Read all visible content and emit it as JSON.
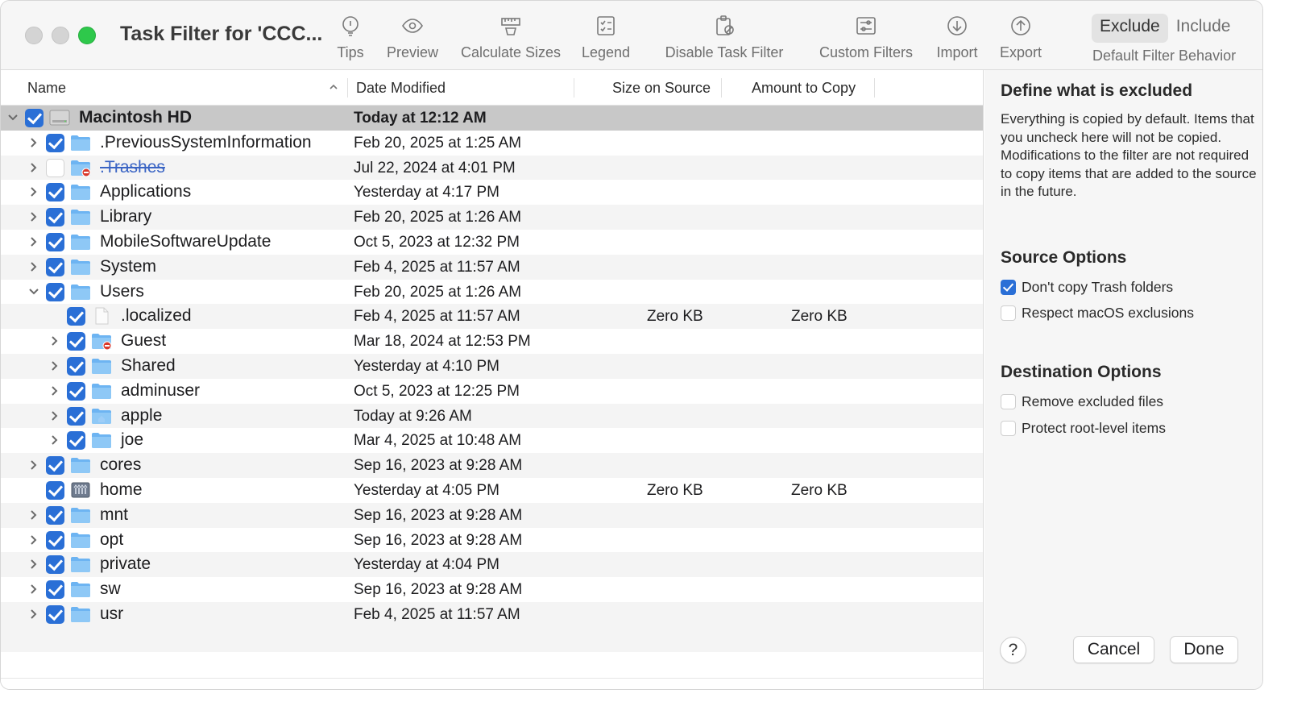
{
  "window": {
    "title": "Task Filter for 'CCC..."
  },
  "toolbar": {
    "buttons": [
      {
        "label": "Tips",
        "icon": "lightbulb-icon"
      },
      {
        "label": "Preview",
        "icon": "eye-icon"
      },
      {
        "label": "Calculate Sizes",
        "icon": "ruler-icon"
      },
      {
        "label": "Legend",
        "icon": "checklist-icon"
      },
      {
        "label": "Disable Task Filter",
        "icon": "clipboard-slash-icon"
      },
      {
        "label": "Custom Filters",
        "icon": "sliders-icon"
      },
      {
        "label": "Import",
        "icon": "arrow-down-circle-icon"
      },
      {
        "label": "Export",
        "icon": "arrow-up-circle-icon"
      }
    ],
    "filter_behavior": {
      "options": [
        "Exclude",
        "Include"
      ],
      "selected": "Exclude",
      "label": "Default Filter Behavior"
    }
  },
  "table": {
    "columns": [
      "Name",
      "Date Modified",
      "Size on Source",
      "Amount to Copy"
    ],
    "rows": [
      {
        "level": 0,
        "name": "Macintosh HD",
        "date": "Today at 12:12 AM",
        "size": "",
        "amount": "",
        "checked": true,
        "icon": "disk",
        "disclosure": "expanded",
        "selected": true
      },
      {
        "level": 1,
        "name": ".PreviousSystemInformation",
        "date": "Feb 20, 2025 at 1:25 AM",
        "size": "",
        "amount": "",
        "checked": true,
        "icon": "folder",
        "disclosure": "collapsed"
      },
      {
        "level": 1,
        "name": ".Trashes",
        "date": "Jul 22, 2024 at 4:01 PM",
        "size": "",
        "amount": "",
        "checked": false,
        "icon": "folder-restricted",
        "disclosure": "collapsed",
        "excluded": true
      },
      {
        "level": 1,
        "name": "Applications",
        "date": "Yesterday at 4:17 PM",
        "size": "",
        "amount": "",
        "checked": true,
        "icon": "folder",
        "disclosure": "collapsed"
      },
      {
        "level": 1,
        "name": "Library",
        "date": "Feb 20, 2025 at 1:26 AM",
        "size": "",
        "amount": "",
        "checked": true,
        "icon": "folder",
        "disclosure": "collapsed"
      },
      {
        "level": 1,
        "name": "MobileSoftwareUpdate",
        "date": "Oct 5, 2023 at 12:32 PM",
        "size": "",
        "amount": "",
        "checked": true,
        "icon": "folder",
        "disclosure": "collapsed"
      },
      {
        "level": 1,
        "name": "System",
        "date": "Feb 4, 2025 at 11:57 AM",
        "size": "",
        "amount": "",
        "checked": true,
        "icon": "folder",
        "disclosure": "collapsed"
      },
      {
        "level": 1,
        "name": "Users",
        "date": "Feb 20, 2025 at 1:26 AM",
        "size": "",
        "amount": "",
        "checked": true,
        "icon": "folder",
        "disclosure": "expanded"
      },
      {
        "level": 2,
        "name": ".localized",
        "date": "Feb 4, 2025 at 11:57 AM",
        "size": "Zero KB",
        "amount": "Zero KB",
        "checked": true,
        "icon": "file",
        "disclosure": "none"
      },
      {
        "level": 2,
        "name": "Guest",
        "date": "Mar 18, 2024 at 12:53 PM",
        "size": "",
        "amount": "",
        "checked": true,
        "icon": "folder-restricted",
        "disclosure": "collapsed"
      },
      {
        "level": 2,
        "name": "Shared",
        "date": "Yesterday at 4:10 PM",
        "size": "",
        "amount": "",
        "checked": true,
        "icon": "folder",
        "disclosure": "collapsed"
      },
      {
        "level": 2,
        "name": "adminuser",
        "date": "Oct 5, 2023 at 12:25 PM",
        "size": "",
        "amount": "",
        "checked": true,
        "icon": "folder",
        "disclosure": "collapsed"
      },
      {
        "level": 2,
        "name": "apple",
        "date": "Today at 9:26 AM",
        "size": "",
        "amount": "",
        "checked": true,
        "icon": "folder-home",
        "disclosure": "collapsed"
      },
      {
        "level": 2,
        "name": "joe",
        "date": "Mar 4, 2025 at 10:48 AM",
        "size": "",
        "amount": "",
        "checked": true,
        "icon": "folder",
        "disclosure": "collapsed"
      },
      {
        "level": 1,
        "name": "cores",
        "date": "Sep 16, 2023 at 9:28 AM",
        "size": "",
        "amount": "",
        "checked": true,
        "icon": "folder",
        "disclosure": "collapsed"
      },
      {
        "level": 1,
        "name": "home",
        "date": "Yesterday at 4:05 PM",
        "size": "Zero KB",
        "amount": "Zero KB",
        "checked": true,
        "icon": "server",
        "disclosure": "none"
      },
      {
        "level": 1,
        "name": "mnt",
        "date": "Sep 16, 2023 at 9:28 AM",
        "size": "",
        "amount": "",
        "checked": true,
        "icon": "folder",
        "disclosure": "collapsed"
      },
      {
        "level": 1,
        "name": "opt",
        "date": "Sep 16, 2023 at 9:28 AM",
        "size": "",
        "amount": "",
        "checked": true,
        "icon": "folder",
        "disclosure": "collapsed"
      },
      {
        "level": 1,
        "name": "private",
        "date": "Yesterday at 4:04 PM",
        "size": "",
        "amount": "",
        "checked": true,
        "icon": "folder",
        "disclosure": "collapsed"
      },
      {
        "level": 1,
        "name": "sw",
        "date": "Sep 16, 2023 at 9:28 AM",
        "size": "",
        "amount": "",
        "checked": true,
        "icon": "folder",
        "disclosure": "collapsed"
      },
      {
        "level": 1,
        "name": "usr",
        "date": "Feb 4, 2025 at 11:57 AM",
        "size": "",
        "amount": "",
        "checked": true,
        "icon": "folder",
        "disclosure": "collapsed"
      }
    ]
  },
  "side_panel": {
    "heading": "Define what is excluded",
    "description": "Everything is copied by default. Items that you uncheck here will not be copied. Modifications to the filter are not required to copy items that are added to the source in the future.",
    "source_options": {
      "heading": "Source Options",
      "items": [
        {
          "label": "Don't copy Trash folders",
          "checked": true
        },
        {
          "label": "Respect macOS exclusions",
          "checked": false
        }
      ]
    },
    "destination_options": {
      "heading": "Destination Options",
      "items": [
        {
          "label": "Remove excluded files",
          "checked": false
        },
        {
          "label": "Protect root-level items",
          "checked": false
        }
      ]
    },
    "help_label": "?",
    "cancel_label": "Cancel",
    "done_label": "Done"
  },
  "colors": {
    "checkbox_blue": "#2a6fd6",
    "folder_blue": "#6db4f2",
    "selected_row": "#c8c8c8",
    "zoom_green": "#2ec84b"
  }
}
